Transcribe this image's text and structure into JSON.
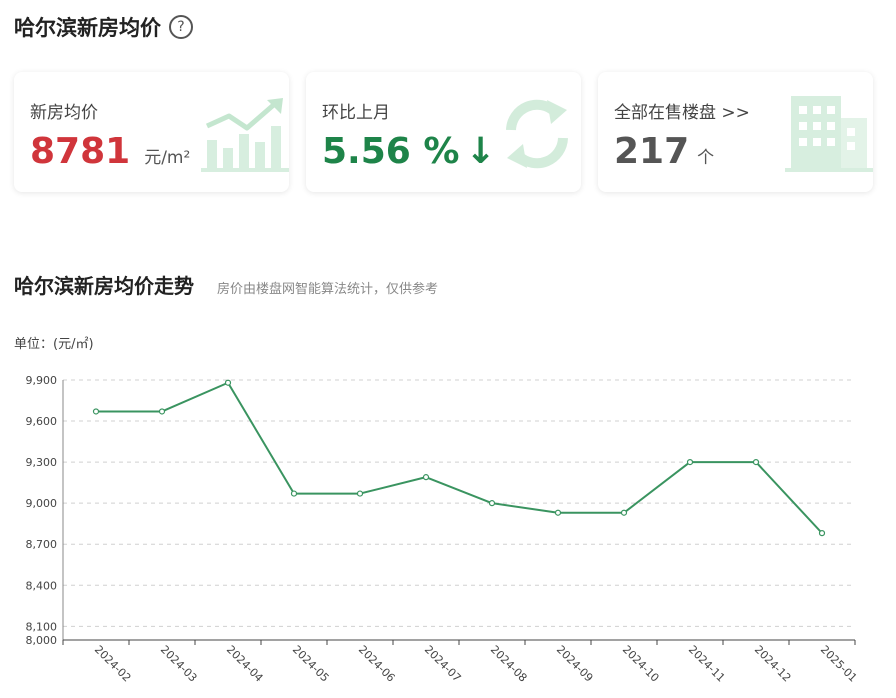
{
  "page_title": "哈尔滨新房均价",
  "help_icon_glyph": "?",
  "cards": [
    {
      "label": "新房均价",
      "value": "8781",
      "unit": "元/m²",
      "value_color": "#d0353b",
      "icon": "chart-growth-icon"
    },
    {
      "label": "环比上月",
      "value": "5.56 %",
      "arrow": "↓",
      "value_color": "#1e8449",
      "icon": "refresh-cycle-icon"
    },
    {
      "label": "全部在售楼盘 >>",
      "value": "217",
      "unit": "个",
      "value_color": "#555555",
      "icon": "building-icon"
    }
  ],
  "trend": {
    "title": "哈尔滨新房均价走势",
    "note": "房价由楼盘网智能算法统计，仅供参考",
    "unit_label": "单位：(元/㎡)"
  },
  "colors": {
    "line": "#3a9460",
    "grid": "#d0d0d0",
    "icon_fill": "#c9e8d4"
  },
  "chart_data": {
    "type": "line",
    "x": [
      "2024-02",
      "2024-03",
      "2024-04",
      "2024-05",
      "2024-06",
      "2024-07",
      "2024-08",
      "2024-09",
      "2024-10",
      "2024-11",
      "2024-12",
      "2025-01"
    ],
    "series": [
      {
        "values": [
          9670,
          9670,
          9880,
          9070,
          9070,
          9190,
          9000,
          8930,
          8930,
          9300,
          9300,
          8781
        ]
      }
    ],
    "yticks": [
      8000,
      8100,
      8400,
      8700,
      9000,
      9300,
      9600,
      9900
    ],
    "ylim": [
      8000,
      9900
    ],
    "ylabel": "单位：(元/㎡)",
    "grid": true,
    "legend": "none"
  }
}
